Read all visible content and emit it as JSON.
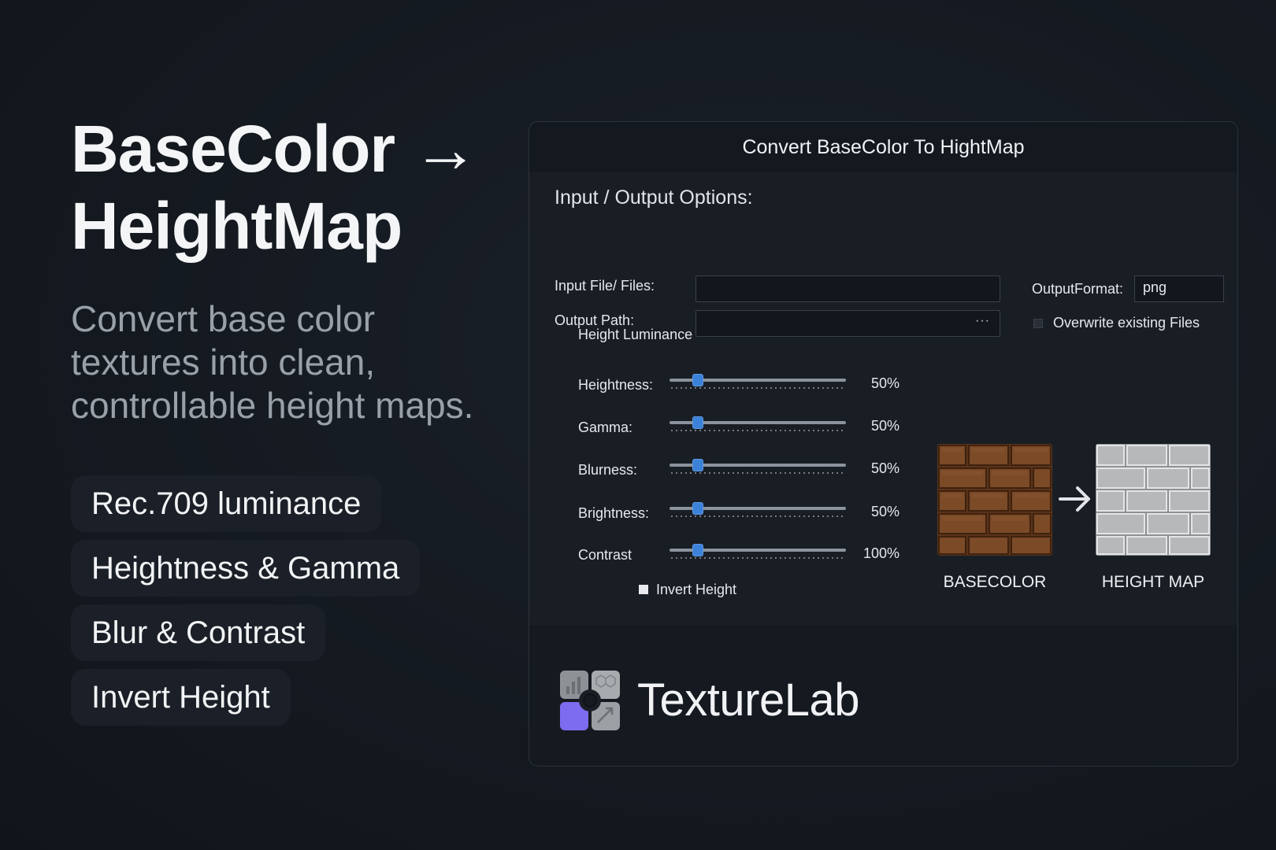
{
  "promo": {
    "title_line1": "BaseColor →",
    "title_line2": "HeightMap",
    "subtitle": "Convert base color textures into clean, controllable height maps.",
    "features": [
      "Rec.709 luminance",
      "Heightness & Gamma",
      "Blur & Contrast",
      "Invert Height"
    ]
  },
  "window": {
    "title": "Convert BaseColor To HightMap",
    "io": {
      "section_label": "Input / Output Options:",
      "input_label": "Input File/ Files:",
      "input_value": "",
      "output_label": "Output Path:",
      "output_value": "",
      "browse_label": "···",
      "format_label": "OutputFormat:",
      "format_value": "png",
      "overwrite_label": "Overwrite existing Files",
      "overwrite_checked": false
    },
    "luminance": {
      "group_label": "Height Luminance",
      "sliders": [
        {
          "label": "Heightness:",
          "value_text": "50%",
          "fill": 0.16
        },
        {
          "label": "Gamma:",
          "value_text": "50%",
          "fill": 0.16
        },
        {
          "label": "Blurness:",
          "value_text": "50%",
          "fill": 0.16
        },
        {
          "label": "Brightness:",
          "value_text": "50%",
          "fill": 0.16
        },
        {
          "label": "Contrast",
          "value_text": "100%",
          "fill": 0.16
        }
      ],
      "invert_label": "Invert Height",
      "invert_checked": true
    },
    "preview": {
      "basecolor_caption": "BASECOLOR",
      "heightmap_caption": "HEIGHT MAP"
    },
    "brand": "TextureLab"
  },
  "colors": {
    "background": "#151a21",
    "accent": "#3b82d8",
    "brick": "#7a4a28",
    "height_gray": "#b4b6b8",
    "logo_purple": "#7b6cf0"
  }
}
